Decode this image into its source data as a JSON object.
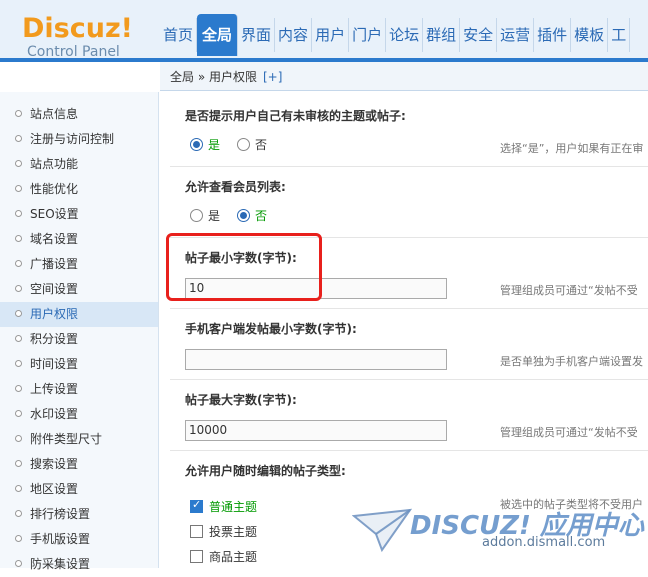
{
  "logo": {
    "name": "Discuz!",
    "subtitle": "Control Panel"
  },
  "nav": {
    "tabs": [
      "首页",
      "全局",
      "界面",
      "内容",
      "用户",
      "门户",
      "论坛",
      "群组",
      "安全",
      "运营",
      "插件",
      "模板",
      "工"
    ],
    "active_index": 1
  },
  "breadcrumb": {
    "path": "全局 » 用户权限",
    "add": "[+]"
  },
  "sidebar": {
    "items": [
      "站点信息",
      "注册与访问控制",
      "站点功能",
      "性能优化",
      "SEO设置",
      "域名设置",
      "广播设置",
      "空间设置",
      "用户权限",
      "积分设置",
      "时间设置",
      "上传设置",
      "水印设置",
      "附件类型尺寸",
      "搜索设置",
      "地区设置",
      "排行榜设置",
      "手机版设置",
      "防采集设置"
    ],
    "active_index": 8
  },
  "settings": {
    "unreviewed_prompt": {
      "label": "是否提示用户自己有未审核的主题或帖子:",
      "yes": "是",
      "no": "否",
      "selected": "yes",
      "hint": "选择“是”，用户如果有正在审"
    },
    "view_member_list": {
      "label": "允许查看会员列表:",
      "yes": "是",
      "no": "否",
      "selected": "no"
    },
    "min_post_chars": {
      "label": "帖子最小字数(字节):",
      "value": "10",
      "hint": "管理组成员可通过“发帖不受"
    },
    "mobile_min_post_chars": {
      "label": "手机客户端发帖最小字数(字节):",
      "value": "",
      "hint": "是否单独为手机客户端设置发"
    },
    "max_post_chars": {
      "label": "帖子最大字数(字节):",
      "value": "10000",
      "hint": "管理组成员可通过“发帖不受"
    },
    "edit_post_types": {
      "label": "允许用户随时编辑的帖子类型:",
      "options": [
        {
          "label": "普通主题",
          "checked": true
        },
        {
          "label": "投票主题",
          "checked": false
        },
        {
          "label": "商品主题",
          "checked": false
        }
      ],
      "hint": "被选中的帖子类型将不受用户"
    }
  },
  "watermark": {
    "title": "DISCUZ! 应用中心",
    "url": "addon.dismall.com"
  },
  "colors": {
    "accent": "#2b7acd",
    "logo": "#f29a1d",
    "annotation": "#e8201c",
    "selected_text": "#009900"
  }
}
